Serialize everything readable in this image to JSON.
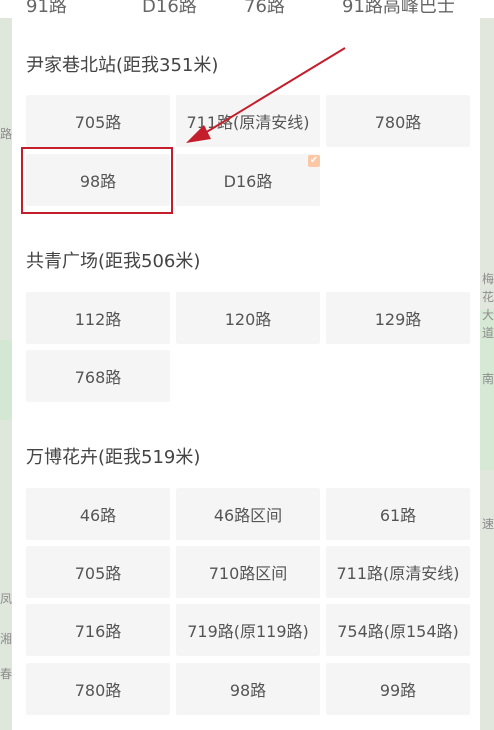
{
  "top_routes": [
    "91路",
    "D16路",
    "76路",
    "91路高峰巴士"
  ],
  "stations": [
    {
      "name": "尹家巷北站(距我351米)",
      "routes": [
        "705路",
        "711路(原清安线)",
        "780路",
        "98路",
        "D16路"
      ]
    },
    {
      "name": "共青广场(距我506米)",
      "routes": [
        "112路",
        "120路",
        "129路",
        "768路"
      ]
    },
    {
      "name": "万博花卉(距我519米)",
      "routes": [
        "46路",
        "46路区间",
        "61路",
        "705路",
        "710路区间",
        "711路(原清安线)",
        "716路",
        "719路(原119路)",
        "754路(原154路)",
        "780路",
        "98路",
        "99路"
      ]
    }
  ],
  "map_labels": {
    "left": [
      "路",
      "凤",
      "湘",
      "春"
    ],
    "right": [
      "梅",
      "花",
      "大",
      "道",
      "南",
      "速"
    ]
  },
  "annotation": {
    "highlight_color": "#c41e2c"
  },
  "favorite_badge": "✔"
}
